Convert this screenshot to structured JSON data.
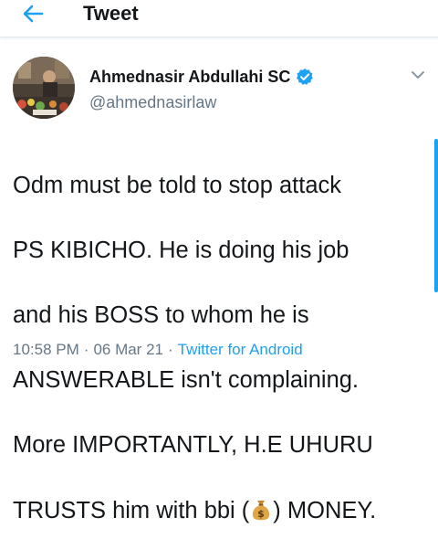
{
  "header": {
    "title": "Tweet",
    "back_icon": "arrow-left-icon"
  },
  "author": {
    "name": "Ahmednasir Abdullahi SC",
    "handle": "@ahmednasirlaw",
    "verified": true
  },
  "tweet": {
    "lines": [
      "Odm must be told to stop attack",
      "PS KIBICHO. He is doing his job",
      "and his BOSS to whom he is",
      "ANSWERABLE isn't complaining.",
      "More IMPORTANTLY, H.E UHURU"
    ],
    "last_line_before": "TRUSTS him with bbi (",
    "last_line_emoji": "money-bag-icon",
    "last_line_after": ") MONEY."
  },
  "meta": {
    "time": "10:58 PM",
    "separator": "·",
    "date": "06 Mar 21",
    "source": "Twitter for Android"
  },
  "colors": {
    "accent": "#1da1f2",
    "text": "#14171a",
    "muted": "#657786"
  }
}
